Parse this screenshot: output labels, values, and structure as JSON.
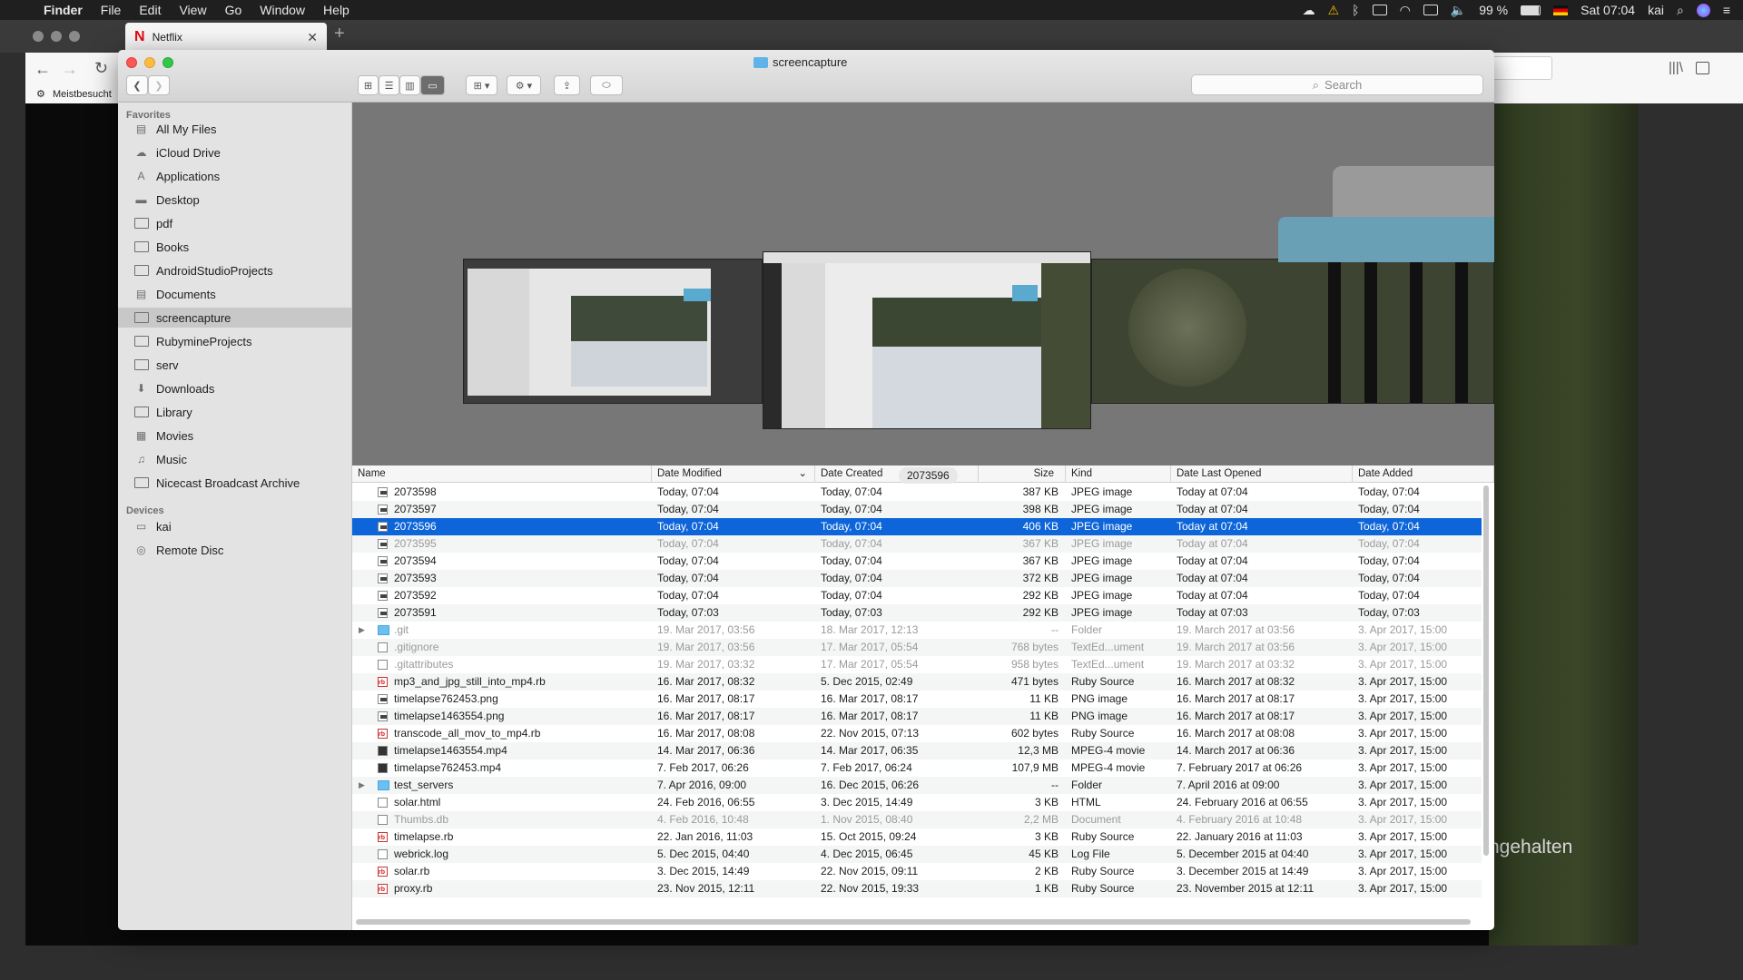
{
  "menubar": {
    "app": "Finder",
    "items": [
      "File",
      "Edit",
      "View",
      "Go",
      "Window",
      "Help"
    ],
    "battery": "99 %",
    "clock": "Sat 07:04",
    "user": "kai"
  },
  "browser": {
    "tab_title": "Netflix",
    "bookmark": "Meistbesucht",
    "video_text": "ngehalten"
  },
  "finder": {
    "title": "screencapture",
    "search_placeholder": "Search",
    "sidebar": {
      "favorites_header": "Favorites",
      "favorites": [
        {
          "label": "All My Files",
          "icon": "all-files-icon"
        },
        {
          "label": "iCloud Drive",
          "icon": "cloud-icon"
        },
        {
          "label": "Applications",
          "icon": "applications-icon"
        },
        {
          "label": "Desktop",
          "icon": "desktop-icon"
        },
        {
          "label": "pdf",
          "icon": "folder-icon"
        },
        {
          "label": "Books",
          "icon": "folder-icon"
        },
        {
          "label": "AndroidStudioProjects",
          "icon": "folder-icon"
        },
        {
          "label": "Documents",
          "icon": "documents-icon"
        },
        {
          "label": "screencapture",
          "icon": "folder-icon",
          "selected": true
        },
        {
          "label": "RubymineProjects",
          "icon": "folder-icon"
        },
        {
          "label": "serv",
          "icon": "folder-icon"
        },
        {
          "label": "Downloads",
          "icon": "downloads-icon"
        },
        {
          "label": "Library",
          "icon": "folder-icon"
        },
        {
          "label": "Movies",
          "icon": "movies-icon"
        },
        {
          "label": "Music",
          "icon": "music-icon"
        },
        {
          "label": "Nicecast Broadcast Archive",
          "icon": "folder-icon"
        }
      ],
      "devices_header": "Devices",
      "devices": [
        {
          "label": "kai",
          "icon": "computer-icon"
        },
        {
          "label": "Remote Disc",
          "icon": "disc-icon"
        }
      ]
    },
    "coverflow_label": "2073596",
    "columns": [
      "Name",
      "Date Modified",
      "Date Created",
      "Size",
      "Kind",
      "Date Last Opened",
      "Date Added"
    ],
    "rows": [
      {
        "name": "2073598",
        "mod": "Today, 07:04",
        "created": "Today, 07:04",
        "size": "387 KB",
        "kind": "JPEG image",
        "opened": "Today at 07:04",
        "added": "Today, 07:04",
        "icon": "img"
      },
      {
        "name": "2073597",
        "mod": "Today, 07:04",
        "created": "Today, 07:04",
        "size": "398 KB",
        "kind": "JPEG image",
        "opened": "Today at 07:04",
        "added": "Today, 07:04",
        "icon": "img"
      },
      {
        "name": "2073596",
        "mod": "Today, 07:04",
        "created": "Today, 07:04",
        "size": "406 KB",
        "kind": "JPEG image",
        "opened": "Today at 07:04",
        "added": "Today, 07:04",
        "icon": "img",
        "selected": true
      },
      {
        "name": "2073595",
        "mod": "Today, 07:04",
        "created": "Today, 07:04",
        "size": "367 KB",
        "kind": "JPEG image",
        "opened": "Today at 07:04",
        "added": "Today, 07:04",
        "icon": "img",
        "dim": true
      },
      {
        "name": "2073594",
        "mod": "Today, 07:04",
        "created": "Today, 07:04",
        "size": "367 KB",
        "kind": "JPEG image",
        "opened": "Today at 07:04",
        "added": "Today, 07:04",
        "icon": "img"
      },
      {
        "name": "2073593",
        "mod": "Today, 07:04",
        "created": "Today, 07:04",
        "size": "372 KB",
        "kind": "JPEG image",
        "opened": "Today at 07:04",
        "added": "Today, 07:04",
        "icon": "img"
      },
      {
        "name": "2073592",
        "mod": "Today, 07:04",
        "created": "Today, 07:04",
        "size": "292 KB",
        "kind": "JPEG image",
        "opened": "Today at 07:04",
        "added": "Today, 07:04",
        "icon": "img"
      },
      {
        "name": "2073591",
        "mod": "Today, 07:03",
        "created": "Today, 07:03",
        "size": "292 KB",
        "kind": "JPEG image",
        "opened": "Today at 07:03",
        "added": "Today, 07:03",
        "icon": "img"
      },
      {
        "name": ".git",
        "mod": "19. Mar 2017, 03:56",
        "created": "18. Mar 2017, 12:13",
        "size": "--",
        "kind": "Folder",
        "opened": "19. March 2017 at 03:56",
        "added": "3. Apr 2017, 15:00",
        "icon": "fold2",
        "dim": true,
        "disclosure": true
      },
      {
        "name": ".gitignore",
        "mod": "19. Mar 2017, 03:56",
        "created": "17. Mar 2017, 05:54",
        "size": "768 bytes",
        "kind": "TextEd...ument",
        "opened": "19. March 2017 at 03:56",
        "added": "3. Apr 2017, 15:00",
        "icon": "doc",
        "dim": true
      },
      {
        "name": ".gitattributes",
        "mod": "19. Mar 2017, 03:32",
        "created": "17. Mar 2017, 05:54",
        "size": "958 bytes",
        "kind": "TextEd...ument",
        "opened": "19. March 2017 at 03:32",
        "added": "3. Apr 2017, 15:00",
        "icon": "doc",
        "dim": true
      },
      {
        "name": "mp3_and_jpg_still_into_mp4.rb",
        "mod": "16. Mar 2017, 08:32",
        "created": "5. Dec 2015, 02:49",
        "size": "471 bytes",
        "kind": "Ruby Source",
        "opened": "16. March 2017 at 08:32",
        "added": "3. Apr 2017, 15:00",
        "icon": "rb"
      },
      {
        "name": "timelapse762453.png",
        "mod": "16. Mar 2017, 08:17",
        "created": "16. Mar 2017, 08:17",
        "size": "11 KB",
        "kind": "PNG image",
        "opened": "16. March 2017 at 08:17",
        "added": "3. Apr 2017, 15:00",
        "icon": "img"
      },
      {
        "name": "timelapse1463554.png",
        "mod": "16. Mar 2017, 08:17",
        "created": "16. Mar 2017, 08:17",
        "size": "11 KB",
        "kind": "PNG image",
        "opened": "16. March 2017 at 08:17",
        "added": "3. Apr 2017, 15:00",
        "icon": "img"
      },
      {
        "name": "transcode_all_mov_to_mp4.rb",
        "mod": "16. Mar 2017, 08:08",
        "created": "22. Nov 2015, 07:13",
        "size": "602 bytes",
        "kind": "Ruby Source",
        "opened": "16. March 2017 at 08:08",
        "added": "3. Apr 2017, 15:00",
        "icon": "rb"
      },
      {
        "name": "timelapse1463554.mp4",
        "mod": "14. Mar 2017, 06:36",
        "created": "14. Mar 2017, 06:35",
        "size": "12,3 MB",
        "kind": "MPEG-4 movie",
        "opened": "14. March 2017 at 06:36",
        "added": "3. Apr 2017, 15:00",
        "icon": "mov"
      },
      {
        "name": "timelapse762453.mp4",
        "mod": "7. Feb 2017, 06:26",
        "created": "7. Feb 2017, 06:24",
        "size": "107,9 MB",
        "kind": "MPEG-4 movie",
        "opened": "7. February 2017 at 06:26",
        "added": "3. Apr 2017, 15:00",
        "icon": "mov"
      },
      {
        "name": "test_servers",
        "mod": "7. Apr 2016, 09:00",
        "created": "16. Dec 2015, 06:26",
        "size": "--",
        "kind": "Folder",
        "opened": "7. April 2016 at 09:00",
        "added": "3. Apr 2017, 15:00",
        "icon": "fold2",
        "disclosure": true
      },
      {
        "name": "solar.html",
        "mod": "24. Feb 2016, 06:55",
        "created": "3. Dec 2015, 14:49",
        "size": "3 KB",
        "kind": "HTML",
        "opened": "24. February 2016 at 06:55",
        "added": "3. Apr 2017, 15:00",
        "icon": "doc"
      },
      {
        "name": "Thumbs.db",
        "mod": "4. Feb 2016, 10:48",
        "created": "1. Nov 2015, 08:40",
        "size": "2,2 MB",
        "kind": "Document",
        "opened": "4. February 2016 at 10:48",
        "added": "3. Apr 2017, 15:00",
        "icon": "doc",
        "dim": true
      },
      {
        "name": "timelapse.rb",
        "mod": "22. Jan 2016, 11:03",
        "created": "15. Oct 2015, 09:24",
        "size": "3 KB",
        "kind": "Ruby Source",
        "opened": "22. January 2016 at 11:03",
        "added": "3. Apr 2017, 15:00",
        "icon": "rb"
      },
      {
        "name": "webrick.log",
        "mod": "5. Dec 2015, 04:40",
        "created": "4. Dec 2015, 06:45",
        "size": "45 KB",
        "kind": "Log File",
        "opened": "5. December 2015 at 04:40",
        "added": "3. Apr 2017, 15:00",
        "icon": "doc"
      },
      {
        "name": "solar.rb",
        "mod": "3. Dec 2015, 14:49",
        "created": "22. Nov 2015, 09:11",
        "size": "2 KB",
        "kind": "Ruby Source",
        "opened": "3. December 2015 at 14:49",
        "added": "3. Apr 2017, 15:00",
        "icon": "rb"
      },
      {
        "name": "proxy.rb",
        "mod": "23. Nov 2015, 12:11",
        "created": "22. Nov 2015, 19:33",
        "size": "1 KB",
        "kind": "Ruby Source",
        "opened": "23. November 2015 at 12:11",
        "added": "3. Apr 2017, 15:00",
        "icon": "rb"
      }
    ]
  }
}
